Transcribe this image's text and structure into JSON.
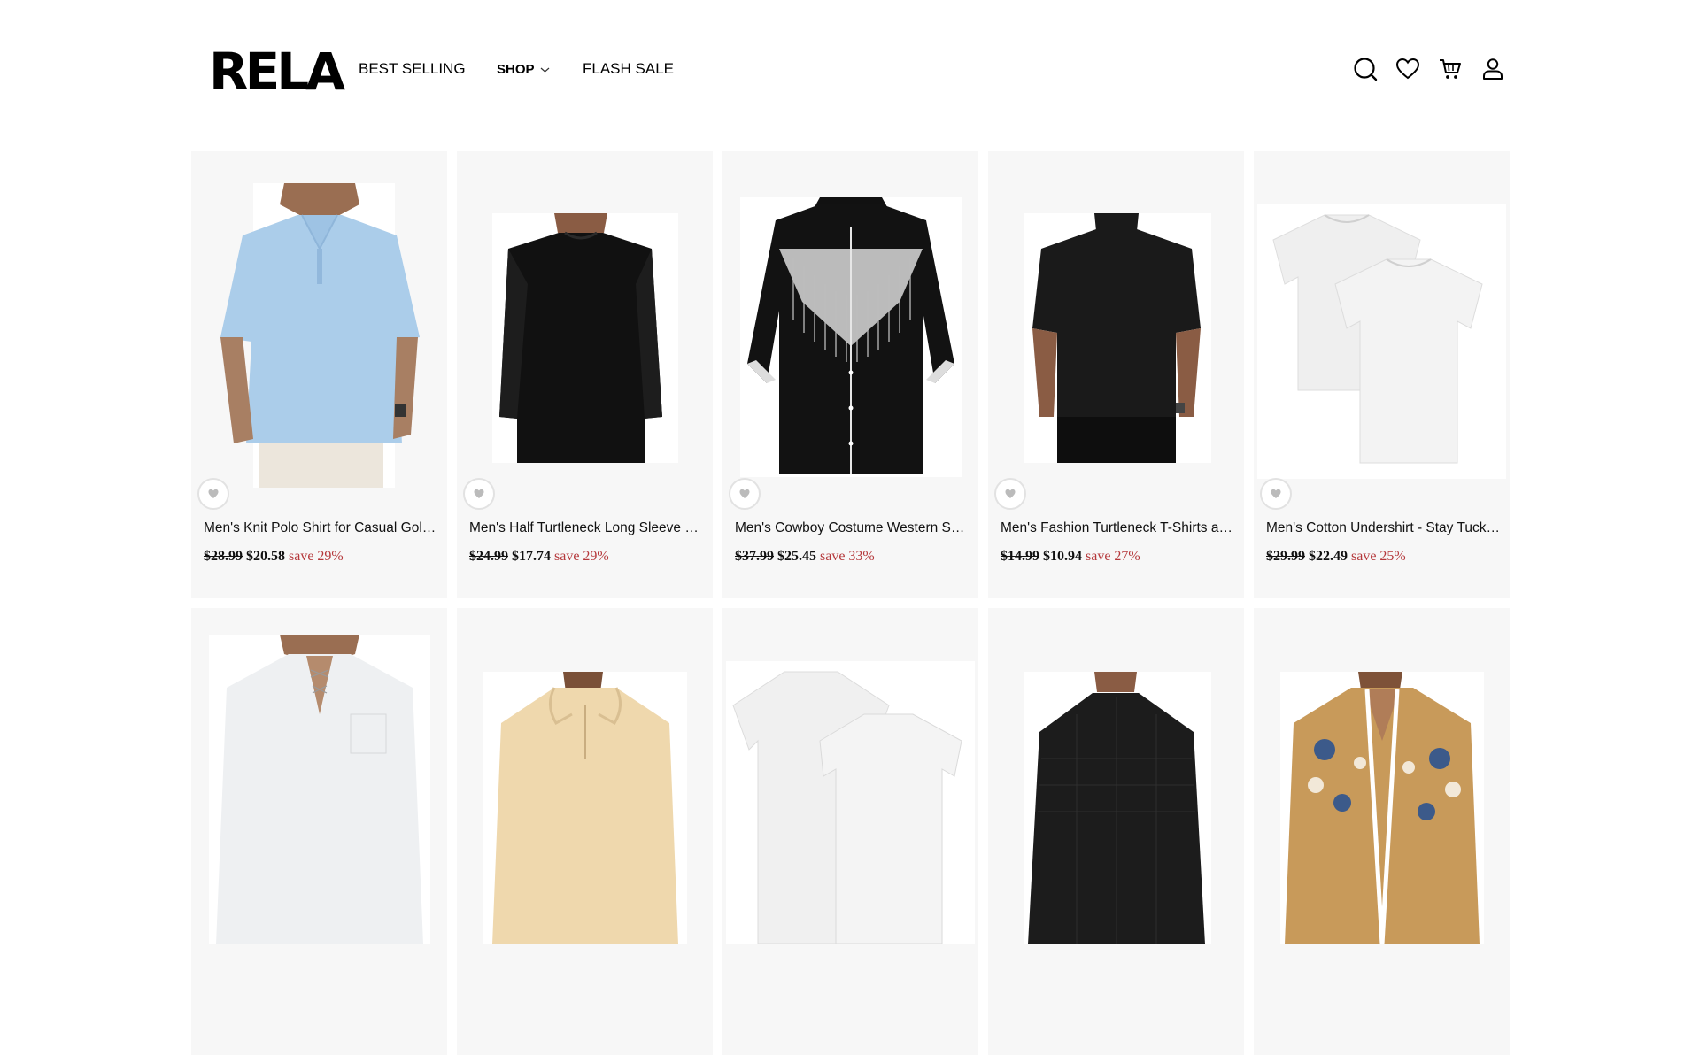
{
  "brand": {
    "logo_text": "RELA"
  },
  "nav": {
    "best_selling": "BEST SELLING",
    "shop": "SHOP",
    "flash_sale": "FLASH SALE"
  },
  "header_icons": [
    "search-icon",
    "heart-icon",
    "cart-icon",
    "account-icon"
  ],
  "colors": {
    "save": "#b5383b",
    "card_bg": "#f7f7f7"
  },
  "products": [
    {
      "title": "Men's Knit Polo Shirt for Casual Golf Shirts",
      "old_price": "$28.99",
      "price": "$20.58",
      "save": "save 29%",
      "image": "light-blue-polo-shirt"
    },
    {
      "title": "Men's Half Turtleneck Long Sleeve Shirts",
      "old_price": "$24.99",
      "price": "$17.74",
      "save": "save 29%",
      "image": "black-long-sleeve-turtleneck"
    },
    {
      "title": "Men's Cowboy Costume Western Shirt",
      "old_price": "$37.99",
      "price": "$25.45",
      "save": "save 33%",
      "image": "black-western-fringe-shirt"
    },
    {
      "title": "Men's Fashion Turtleneck T-Shirts and Tops",
      "old_price": "$14.99",
      "price": "$10.94",
      "save": "save 27%",
      "image": "black-turtleneck-tshirt"
    },
    {
      "title": "Men's Cotton Undershirt - Stay Tucked Shirts",
      "old_price": "$29.99",
      "price": "$22.49",
      "save": "save 25%",
      "image": "white-undershirt-pair"
    },
    {
      "title": "",
      "old_price": "",
      "price": "",
      "save": "",
      "image": "white-lace-up-henley"
    },
    {
      "title": "",
      "old_price": "",
      "price": "",
      "save": "",
      "image": "beige-hooded-henley"
    },
    {
      "title": "",
      "old_price": "",
      "price": "",
      "save": "",
      "image": "white-tshirt-pair"
    },
    {
      "title": "",
      "old_price": "",
      "price": "",
      "save": "",
      "image": "black-knit-turtleneck"
    },
    {
      "title": "",
      "old_price": "",
      "price": "",
      "save": "",
      "image": "paisley-print-shirt"
    }
  ]
}
